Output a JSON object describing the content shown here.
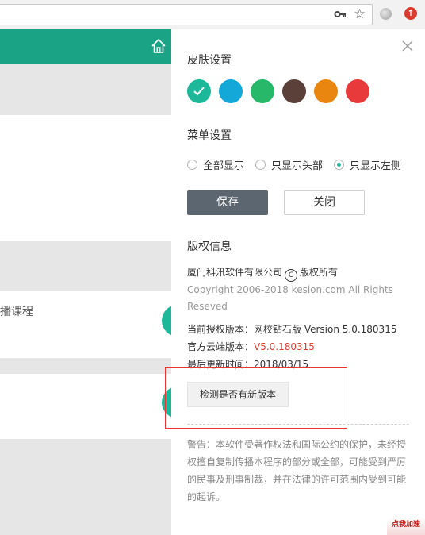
{
  "panel": {
    "skin_title": "皮肤设置",
    "skin_colors": [
      "#1db89a",
      "#13a8d8",
      "#27b86a",
      "#5a4039",
      "#e8860f",
      "#e83a3a"
    ],
    "menu_title": "菜单设置",
    "menu_options": [
      "全部显示",
      "只显示头部",
      "只显示左侧"
    ],
    "menu_selected": "只显示左侧",
    "save_label": "保存",
    "close_label": "关闭",
    "copyright_title": "版权信息",
    "company_name": "厦门科汛软件有限公司",
    "copyright_symbol": "C",
    "rights_text": "版权所有",
    "copyright_line1": "Copyright 2006-2018 kesion.com All Rights",
    "copyright_line2": "Reseved",
    "auth_version": "当前授权版本：网校钻石版 Version 5.0.180315",
    "cloud_version_label": "官方云端版本：",
    "cloud_version_value": "V5.0.180315",
    "last_update": "最后更新时间：2018/03/15",
    "check_update_label": "检测是否有新版本",
    "warning_text": "警告：本软件受著作权法和国际公约的保护，未经授权擅自复制传播本程序的部分或全部，可能受到严厉的民事及刑事制裁，并在法律的许可范围内受到可能的起诉。"
  },
  "background": {
    "course_text": "播课程"
  },
  "badge": {
    "speed_label": "点我加速"
  },
  "colors": {
    "accent": "#1db89a",
    "header_green": "#1aa384",
    "highlight_red": "#e33333"
  }
}
